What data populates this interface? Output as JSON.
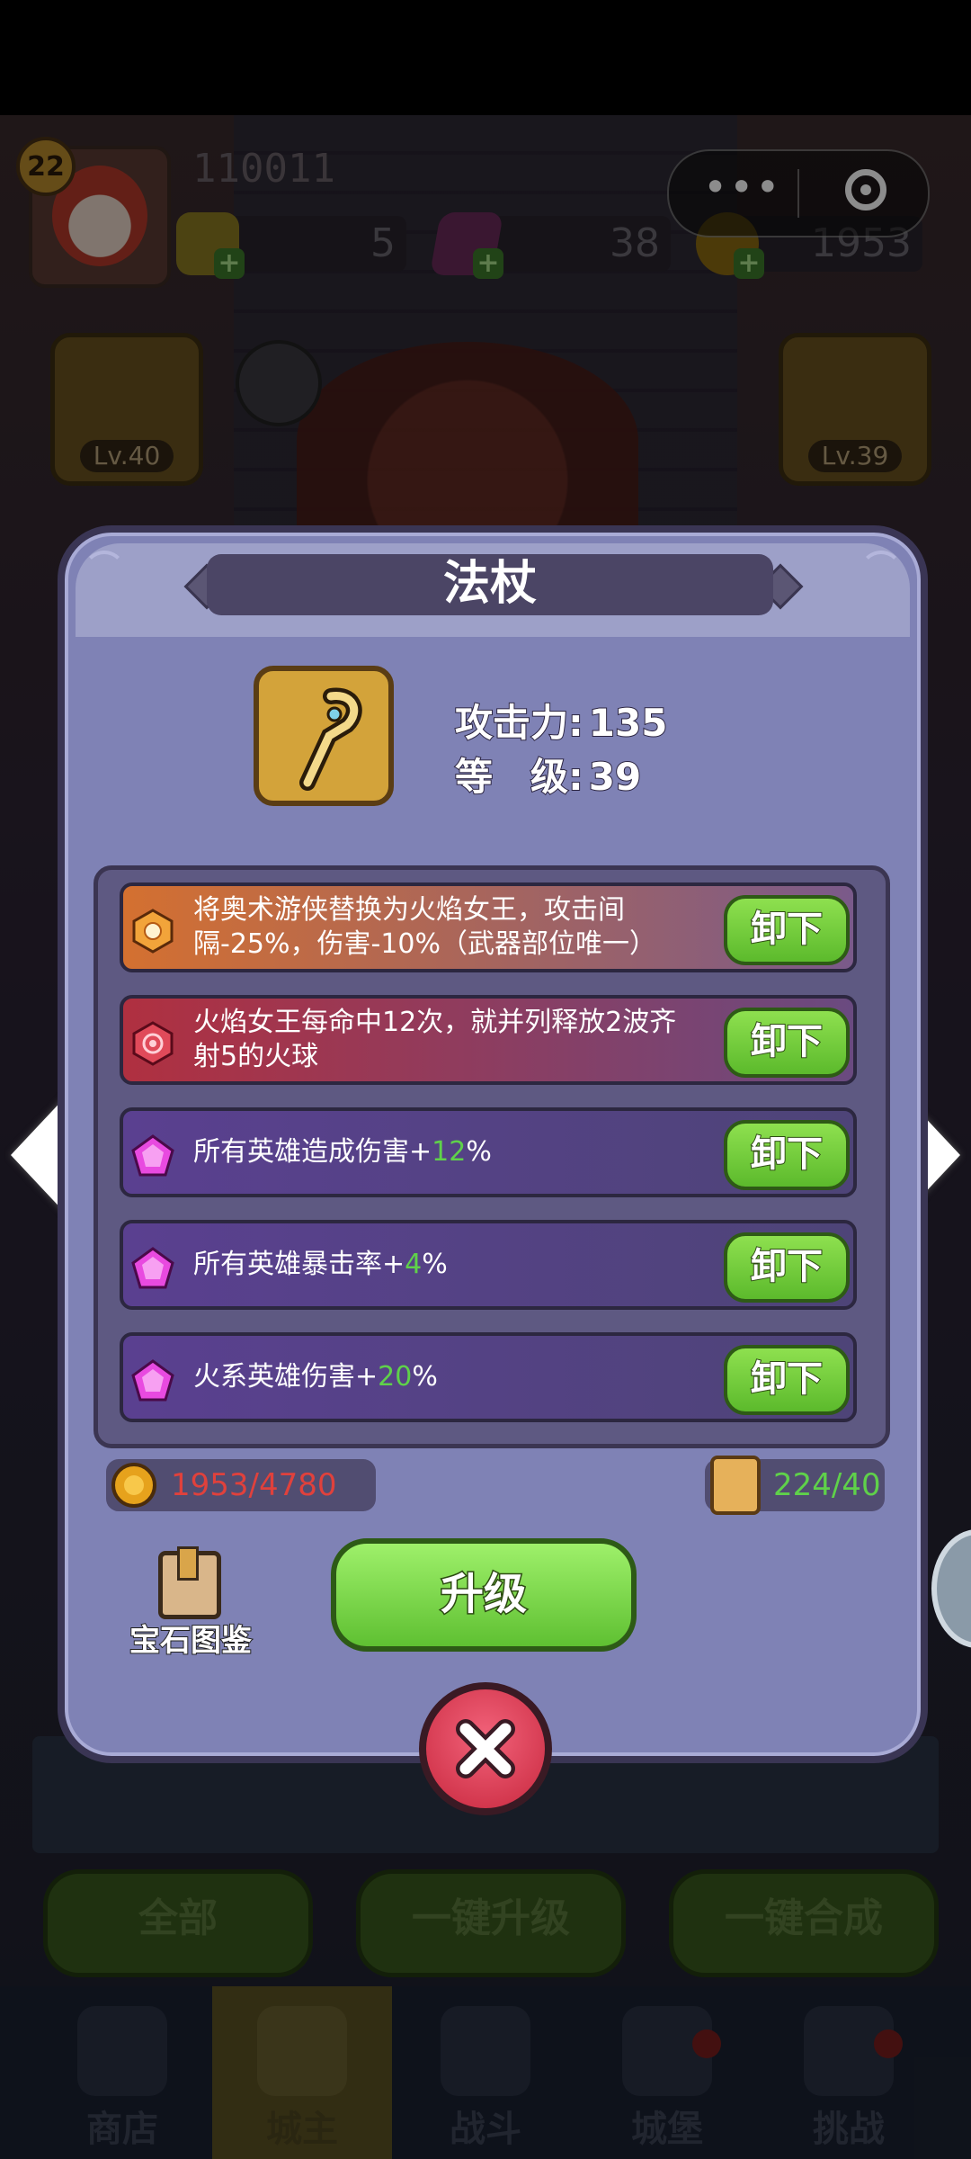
{
  "hud": {
    "player_level": "22",
    "player_id": "110011",
    "resources": [
      {
        "icon": "hex-crystal-icon",
        "value": "5"
      },
      {
        "icon": "purple-gem-icon",
        "value": "38"
      },
      {
        "icon": "gold-coin-icon",
        "value": "1953"
      }
    ],
    "left_card_level": "Lv.40",
    "right_card_level": "Lv.39"
  },
  "dialog": {
    "title": "法杖",
    "item_icon": "staff-icon",
    "stats": [
      {
        "label": "攻击力:",
        "value": "135"
      },
      {
        "label": "等　级:",
        "value": "39"
      }
    ],
    "gems": [
      {
        "icon": "orange-rune-icon",
        "text": "将奥术游侠替换为火焰女王，攻击间隔-25%，伤害-10%（武器部位唯一）",
        "button": "卸下",
        "style": "orange"
      },
      {
        "icon": "red-rune-icon",
        "text": "火焰女王每命中12次，就并列释放2波齐射5的火球",
        "button": "卸下",
        "style": "red"
      },
      {
        "icon": "purple-pentagon-gem-icon",
        "text_prefix": "所有英雄造成伤害+",
        "highlight": "12",
        "text_suffix": "%",
        "button": "卸下",
        "style": "purple"
      },
      {
        "icon": "purple-pentagon-gem-icon",
        "text_prefix": "所有英雄暴击率+",
        "highlight": "4",
        "text_suffix": "%",
        "button": "卸下",
        "style": "purple"
      },
      {
        "icon": "purple-pentagon-gem-icon",
        "text_prefix": "火系英雄伤害+",
        "highlight": "20",
        "text_suffix": "%",
        "button": "卸下",
        "style": "purple"
      }
    ],
    "coin_cost": "1953/4780",
    "scroll_cost": "224/40",
    "coin_cost_color": "#e0413c",
    "scroll_cost_color": "#5fd14a",
    "gem_book_label": "宝石图鉴",
    "upgrade_label": "升级"
  },
  "bottom": {
    "buttons": [
      "全部",
      "一键升级",
      "一键合成"
    ],
    "tabs": [
      "商店",
      "城主",
      "战斗",
      "城堡",
      "挑战"
    ],
    "active_tab": "城主"
  }
}
